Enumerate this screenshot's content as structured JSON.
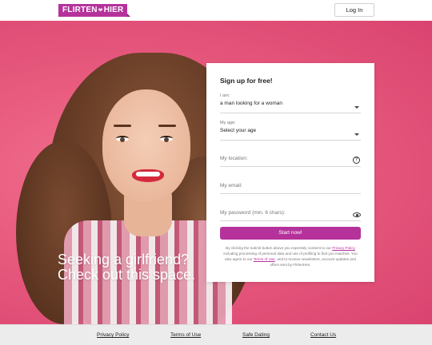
{
  "header": {
    "logo_left": "FLIRTEN",
    "logo_heart": "❤",
    "logo_right": "HIER",
    "login_label": "Log In"
  },
  "hero": {
    "tagline_line1": "Seeking a girlfriend?",
    "tagline_line2": "Check out this space."
  },
  "form": {
    "title": "Sign up for free!",
    "i_am": {
      "label": "I am:",
      "value": "a man looking for a woman"
    },
    "age": {
      "label": "My age:",
      "value": "Select your age"
    },
    "location": {
      "placeholder": "My location:"
    },
    "email": {
      "placeholder": "My email:"
    },
    "password": {
      "placeholder": "My password (min. 6 chars):"
    },
    "submit_label": "Start now!",
    "consent": {
      "part1": "By clicking the submit button above you expressly consent to our",
      "privacy_link": "Privacy Policy",
      "part2": "including processing of personal data and use of profiling to find you matches. You also agree to our",
      "terms_link": "Terms of Use",
      "part3": ", and to receive newsletters, account updates and offers sent by FlirtenHier."
    }
  },
  "footer": {
    "links": [
      "Privacy Policy",
      "Terms of Use",
      "Safe Dating",
      "Contact Us"
    ]
  },
  "colors": {
    "brand": "#b5329b",
    "hero_bg": "#e85a7e"
  },
  "icons": [
    "chevron-down-icon",
    "question-circle-icon",
    "eye-icon"
  ]
}
